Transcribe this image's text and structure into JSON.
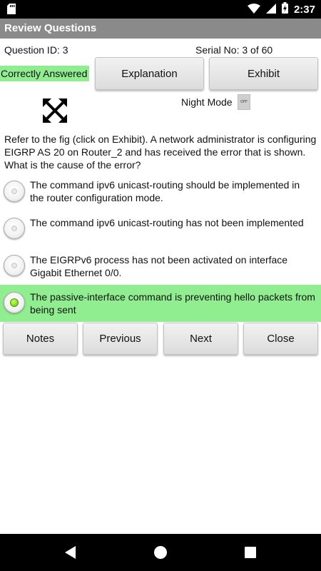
{
  "status_bar": {
    "time": "2:37"
  },
  "app": {
    "title": "Review Questions"
  },
  "info": {
    "question_id": "Question ID: 3",
    "serial": "Serial No: 3 of 60"
  },
  "status_badge": "Correctly Answered",
  "buttons": {
    "explanation": "Explanation",
    "exhibit": "Exhibit",
    "notes": "Notes",
    "previous": "Previous",
    "next": "Next",
    "close": "Close"
  },
  "night_mode": {
    "label": "Night Mode",
    "toggle_text": "OFF",
    "on": false
  },
  "question": {
    "text": "Refer to the fig (click on Exhibit). A network administrator is configuring EIGRP AS 20 on Router_2  and has received the error that is shown. What is the cause of the error?"
  },
  "options": [
    {
      "text": "The command ipv6 unicast-routing should be implemented in the router configuration mode.",
      "selected": false
    },
    {
      "text": "The command ipv6 unicast-routing has not been implemented",
      "selected": false
    },
    {
      "text": "The EIGRPv6 process has not been activated on interface Gigabit Ethernet 0/0.",
      "selected": false
    },
    {
      "text": "The passive-interface command is preventing hello packets from being sent",
      "selected": true
    }
  ],
  "colors": {
    "correct_highlight": "#90ee90",
    "title_bar": "#8a8a8a",
    "status_bar": "#000000"
  },
  "icons": {
    "expand": "expand-arrows-icon",
    "sd": "sd-card-icon",
    "wifi": "wifi-icon",
    "signal": "signal-icon",
    "battery": "battery-charging-icon",
    "back": "back-icon",
    "home": "home-icon",
    "recents": "recents-icon"
  }
}
